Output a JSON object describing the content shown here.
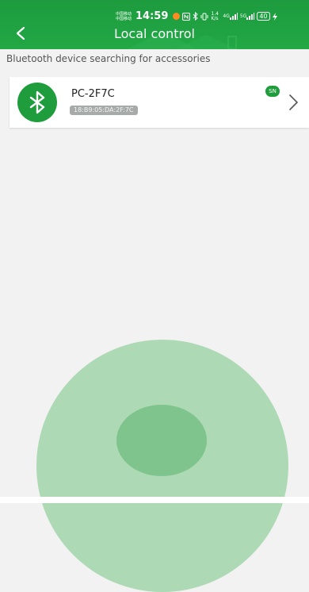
{
  "status_bar": {
    "carrier_1": "中国移动",
    "carrier_2": "中国移动",
    "time": "14:59",
    "net_speed": "1.4 K/s",
    "signal_1": "4G",
    "signal_2": "5G",
    "battery": "40"
  },
  "header": {
    "title": "Local control"
  },
  "subheader": "Bluetooth device searching for accessories",
  "device": {
    "name": "PC-2F7C",
    "mac": "18:B9:05:DA:2F:7C",
    "badge": "SN"
  },
  "colors": {
    "primary": "#1d9b3e",
    "outer_scan": "#add9b5",
    "inner_scan": "#7fc48d",
    "mac_badge": "#a6aaa8"
  }
}
